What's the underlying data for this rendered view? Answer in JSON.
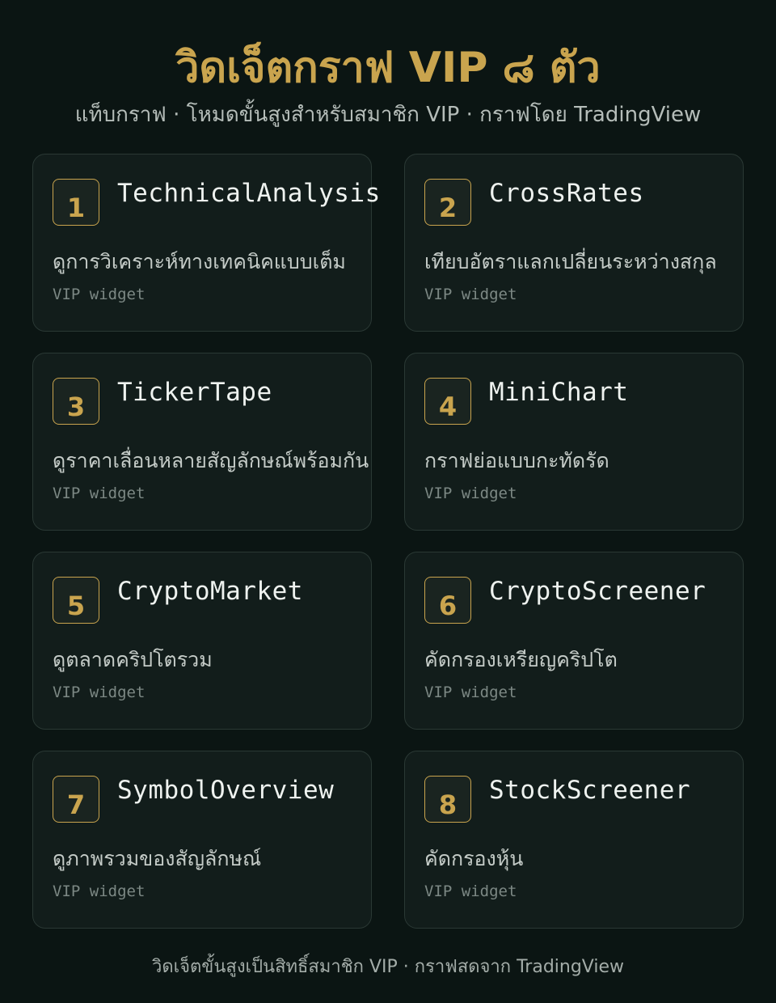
{
  "header": {
    "title": "วิดเจ็ตกราฟ VIP ๘ ตัว",
    "subtitle": "แท็บกราฟ · โหมดขั้นสูงสำหรับสมาชิก VIP · กราฟโดย TradingView"
  },
  "widgets": [
    {
      "number": "1",
      "name": "TechnicalAnalysis",
      "description": "ดูการวิเคราะห์ทางเทคนิคแบบเต็ม",
      "tag": "VIP widget"
    },
    {
      "number": "2",
      "name": "CrossRates",
      "description": "เทียบอัตราแลกเปลี่ยนระหว่างสกุล",
      "tag": "VIP widget"
    },
    {
      "number": "3",
      "name": "TickerTape",
      "description": "ดูราคาเลื่อนหลายสัญลักษณ์พร้อมกัน",
      "tag": "VIP widget"
    },
    {
      "number": "4",
      "name": "MiniChart",
      "description": "กราฟย่อแบบกะทัดรัด",
      "tag": "VIP widget"
    },
    {
      "number": "5",
      "name": "CryptoMarket",
      "description": "ดูตลาดคริปโตรวม",
      "tag": "VIP widget"
    },
    {
      "number": "6",
      "name": "CryptoScreener",
      "description": "คัดกรองเหรียญคริปโต",
      "tag": "VIP widget"
    },
    {
      "number": "7",
      "name": "SymbolOverview",
      "description": "ดูภาพรวมของสัญลักษณ์",
      "tag": "VIP widget"
    },
    {
      "number": "8",
      "name": "StockScreener",
      "description": "คัดกรองหุ้น",
      "tag": "VIP widget"
    }
  ],
  "footer": {
    "text": "วิดเจ็ตขั้นสูงเป็นสิทธิ์สมาชิก VIP · กราฟสดจาก TradingView"
  },
  "colors": {
    "background": "#0b1513",
    "card": "#121d1b",
    "accent_gold": "#c9a44e",
    "border": "#2a3834"
  }
}
